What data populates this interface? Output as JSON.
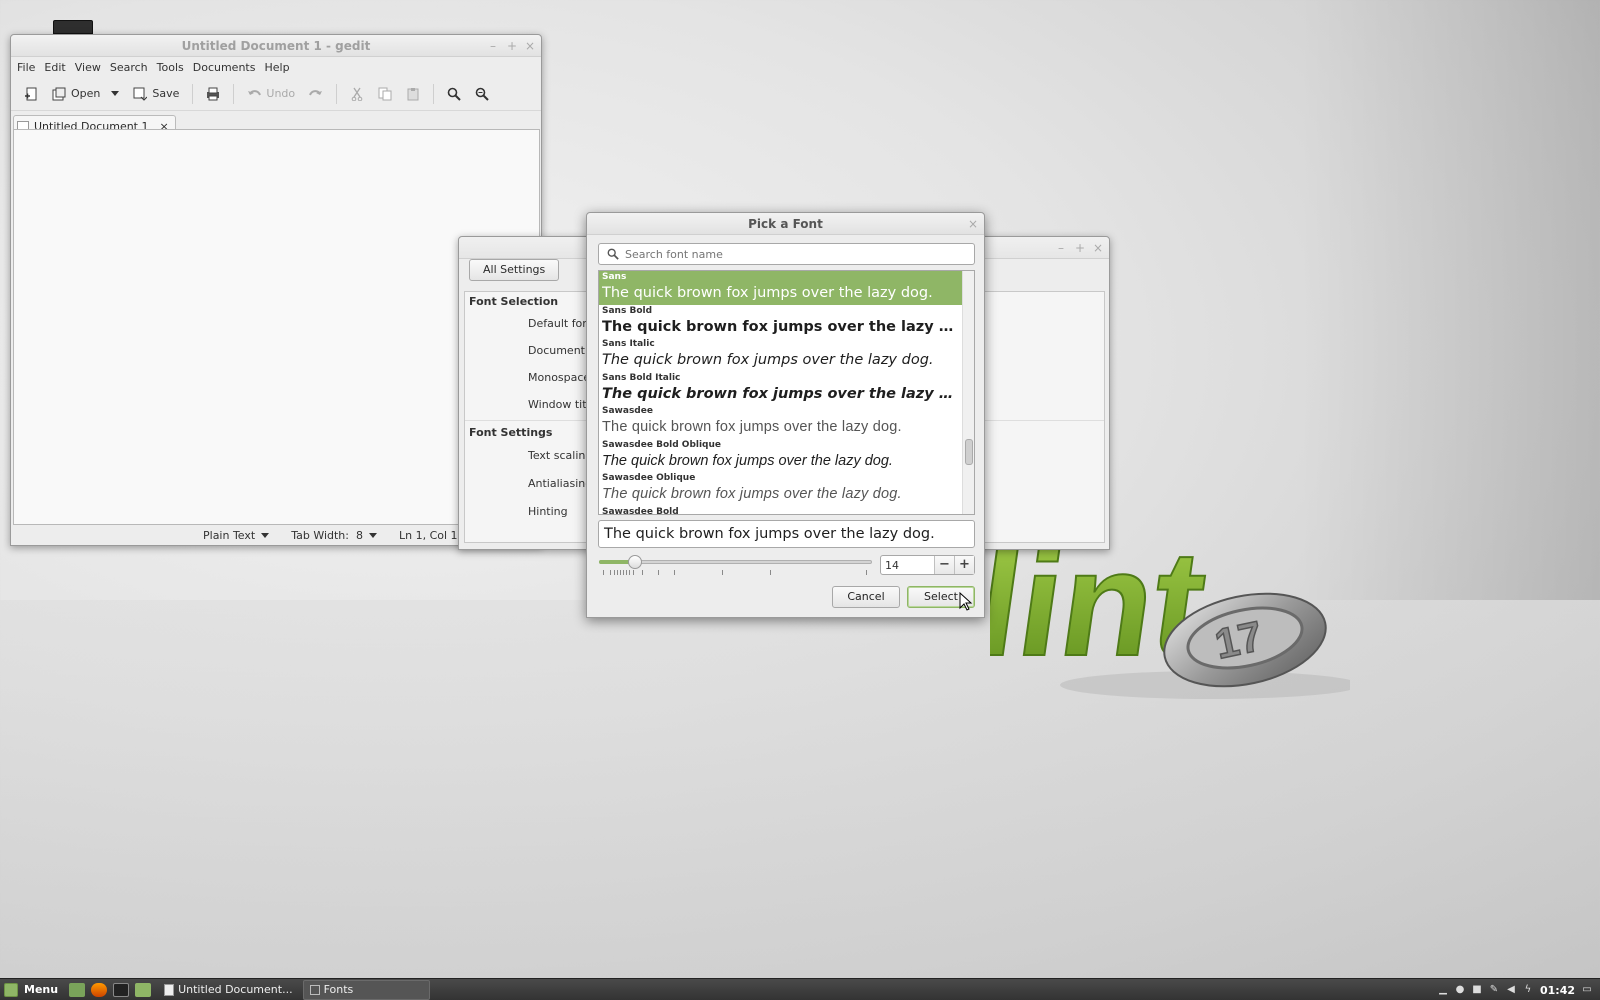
{
  "gedit": {
    "title": "Untitled Document 1 - gedit",
    "menu": [
      "File",
      "Edit",
      "View",
      "Search",
      "Tools",
      "Documents",
      "Help"
    ],
    "toolbar": {
      "open": "Open",
      "save": "Save",
      "undo": "Undo"
    },
    "tab_label": "Untitled Document 1",
    "status": {
      "language": "Plain Text",
      "tab_width": "Tab Width:  8",
      "position": "Ln 1, Col 1"
    }
  },
  "fonts_window": {
    "all_settings": "All Settings",
    "font_selection": "Font Selection",
    "selection_rows": [
      "Default font",
      "Document fo",
      "Monospace",
      "Window title"
    ],
    "font_settings": "Font Settings",
    "settings_rows": [
      "Text scaling",
      "Antialiasing",
      "Hinting"
    ]
  },
  "pick_font": {
    "title": "Pick a Font",
    "search_placeholder": "Search font name",
    "fonts": [
      {
        "name": "Sans",
        "sample": "The quick brown fox jumps over the lazy dog.",
        "selected": true
      },
      {
        "name": "Sans Bold",
        "sample": "The quick brown fox jumps over the lazy d..."
      },
      {
        "name": "Sans Italic",
        "sample": "The quick brown fox jumps over the lazy dog."
      },
      {
        "name": "Sans Bold Italic",
        "sample": "The quick brown fox jumps over the lazy d..."
      },
      {
        "name": "Sawasdee",
        "sample": "The quick brown fox jumps over the lazy dog."
      },
      {
        "name": "Sawasdee Bold Oblique",
        "sample": "The quick brown fox jumps over the lazy dog."
      },
      {
        "name": "Sawasdee Oblique",
        "sample": "The quick brown fox jumps over the lazy dog."
      },
      {
        "name": "Sawasdee Bold",
        "sample": ""
      }
    ],
    "preview_text": "The quick brown fox jumps over the lazy dog.",
    "size": "14",
    "cancel": "Cancel",
    "select": "Select",
    "accent_color": "#8fb666"
  },
  "taskbar": {
    "menu": "Menu",
    "tasks": [
      "Untitled Document...",
      "Fonts"
    ],
    "clock": "01:42"
  },
  "wallpaper_text": "lint",
  "wallpaper_number": "17"
}
